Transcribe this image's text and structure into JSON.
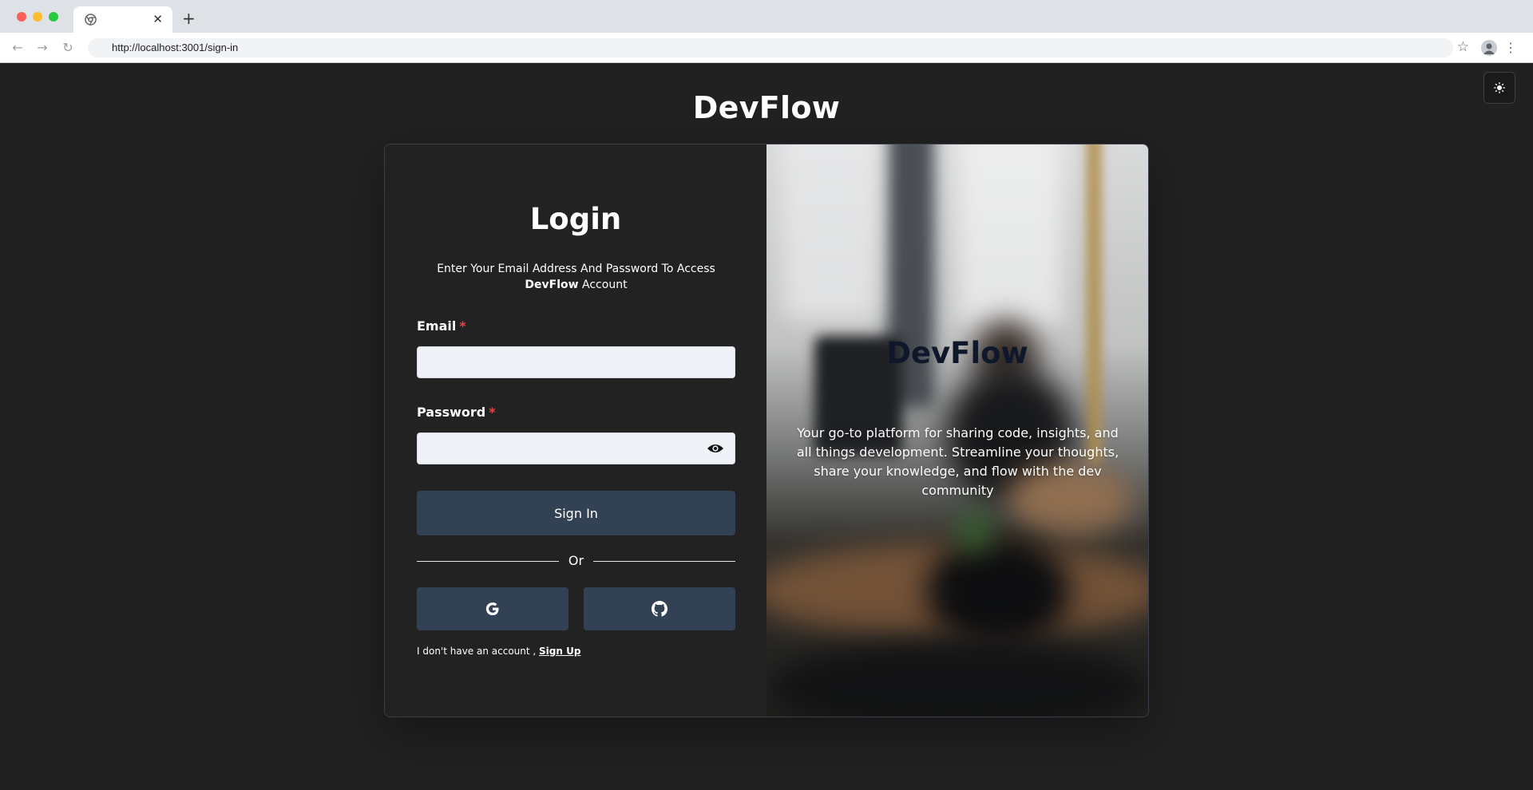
{
  "browser": {
    "url": "http://localhost:3001/sign-in",
    "tab_close": "✕",
    "new_tab": "+"
  },
  "header": {
    "brand": "DevFlow"
  },
  "login": {
    "title": "Login",
    "subtitle_prefix": "Enter Your Email Address And Password To Access ",
    "subtitle_brand": "DevFlow",
    "subtitle_suffix": " Account",
    "email_label": "Email",
    "email_value": "",
    "password_label": "Password",
    "password_value": "",
    "required_mark": "*",
    "signin_label": "Sign In",
    "or_label": "Or",
    "footer_text": "I don't have an account , ",
    "signup_label": "Sign Up"
  },
  "panel": {
    "title": "DevFlow",
    "text": "Your go-to platform for sharing code, insights, and all things development. Streamline your thoughts, share your knowledge, and flow with the dev community"
  },
  "icons": {
    "theme": "sun-icon",
    "google": "google-icon",
    "github": "github-icon",
    "password_toggle": "eye-icon"
  },
  "colors": {
    "page_bg": "#212121",
    "button_bg": "#334155",
    "required": "#ef4444",
    "panel_title": "#0f172a"
  }
}
